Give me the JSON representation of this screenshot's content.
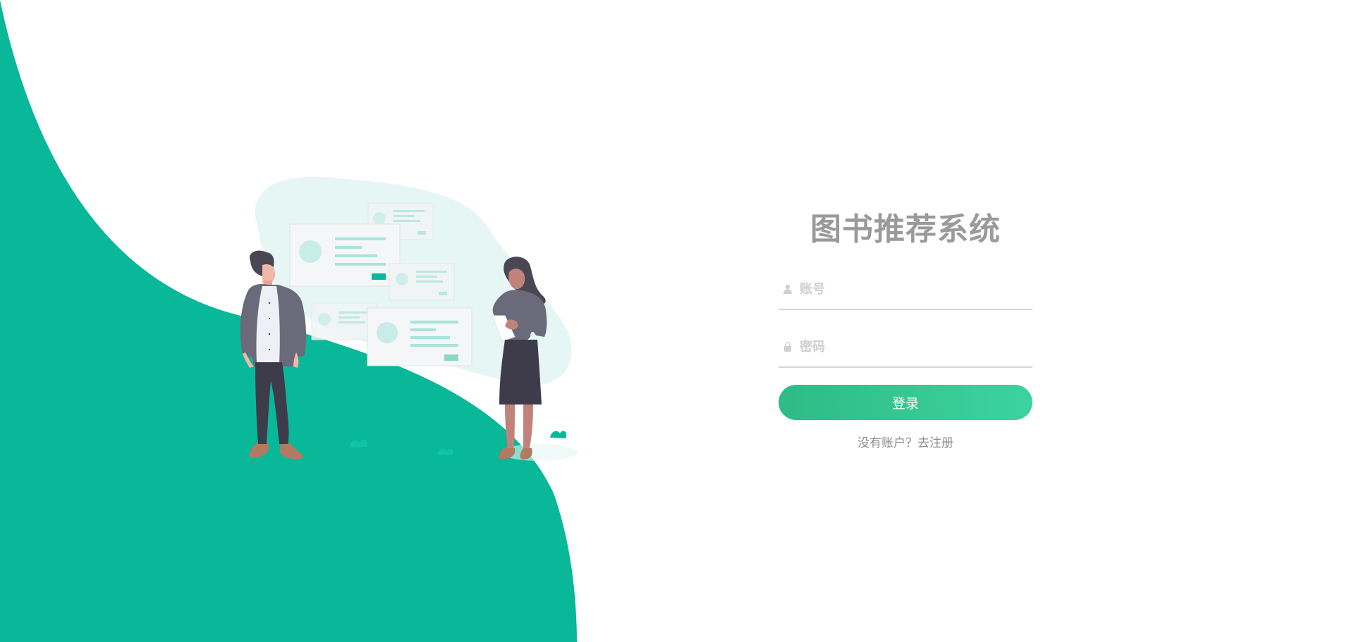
{
  "login": {
    "title": "图书推荐系统",
    "username_placeholder": "账号",
    "password_placeholder": "密码",
    "submit_label": "登录",
    "register_prompt": "没有账户？去注册"
  },
  "icons": {
    "username": "user-icon",
    "password": "lock-icon"
  },
  "colors": {
    "primary_green": "#09b799",
    "button_gradient_start": "#2ebb86",
    "button_gradient_end": "#3cd3a1",
    "title_gray": "#9a9a9a"
  }
}
